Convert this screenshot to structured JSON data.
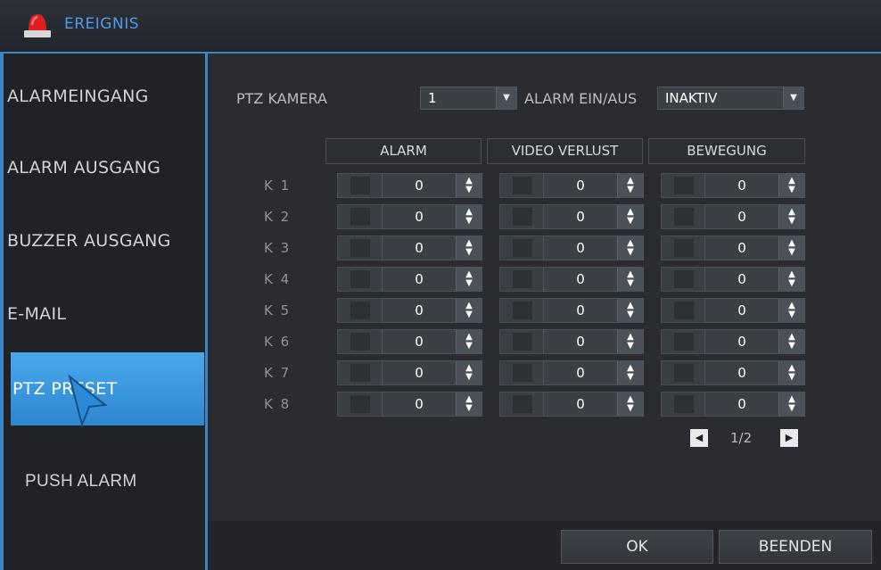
{
  "window": {
    "title": "EREIGNIS",
    "icon": "alarm-siren-icon"
  },
  "sidebar": {
    "items": [
      {
        "label": "ALARMEINGANG"
      },
      {
        "label": "ALARM AUSGANG"
      },
      {
        "label": "BUZZER AUSGANG"
      },
      {
        "label": "E-MAIL"
      },
      {
        "label": "PTZ PRESET"
      },
      {
        "label": "PUSH ALARM"
      }
    ],
    "active": "PTZ PRESET"
  },
  "ptz": {
    "camera_label": "PTZ KAMERA",
    "camera_value": "1",
    "alarm_label": "ALARM EIN/AUS",
    "alarm_value": "INAKTIV"
  },
  "table": {
    "headers": [
      "ALARM",
      "VIDEO VERLUST",
      "BEWEGUNG"
    ],
    "rows": [
      {
        "label": "K 1",
        "alarm": "0",
        "video": "0",
        "motion": "0"
      },
      {
        "label": "K 2",
        "alarm": "0",
        "video": "0",
        "motion": "0"
      },
      {
        "label": "K 3",
        "alarm": "0",
        "video": "0",
        "motion": "0"
      },
      {
        "label": "K 4",
        "alarm": "0",
        "video": "0",
        "motion": "0"
      },
      {
        "label": "K 5",
        "alarm": "0",
        "video": "0",
        "motion": "0"
      },
      {
        "label": "K 6",
        "alarm": "0",
        "video": "0",
        "motion": "0"
      },
      {
        "label": "K 7",
        "alarm": "0",
        "video": "0",
        "motion": "0"
      },
      {
        "label": "K 8",
        "alarm": "0",
        "video": "0",
        "motion": "0"
      }
    ]
  },
  "pagination": {
    "text": "1/2"
  },
  "footer": {
    "ok": "OK",
    "exit": "BEENDEN"
  },
  "colors": {
    "accent": "#3d86c6",
    "active": "#3f9be3",
    "alarm": "#e02020"
  }
}
